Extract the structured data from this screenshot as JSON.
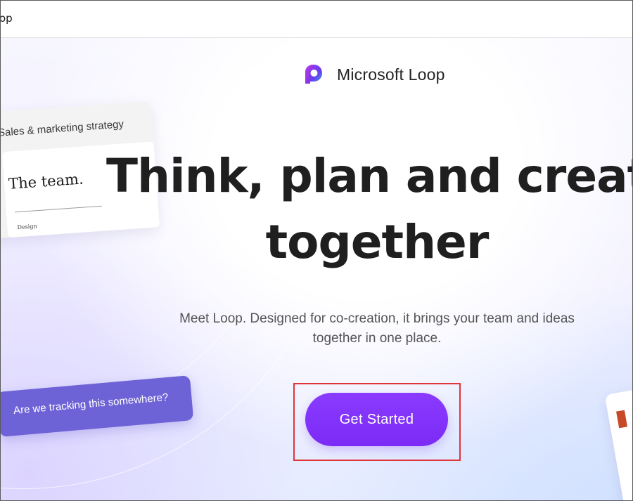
{
  "window": {
    "title_fragment": "op"
  },
  "brand": {
    "name": "Microsoft Loop",
    "logo_icon": "microsoft-loop-logo-icon"
  },
  "hero": {
    "headline_line1": "Think, plan and create",
    "headline_line2": "together",
    "subtitle": "Meet Loop. Designed for co-creation, it brings your team and ideas together in one place.",
    "cta_label": "Get Started"
  },
  "decorations": {
    "strategy_card": {
      "title": "Sales & marketing strategy",
      "heading": "The team.",
      "caption": "Design"
    },
    "chat_bubble": {
      "text": "Are we tracking this somewhere?"
    }
  },
  "colors": {
    "cta": "#7b2bf5",
    "highlight_border": "#e0353b",
    "headline": "#1f1f1f",
    "subtitle": "#555555",
    "chat_bubble": "#6d63d6"
  }
}
